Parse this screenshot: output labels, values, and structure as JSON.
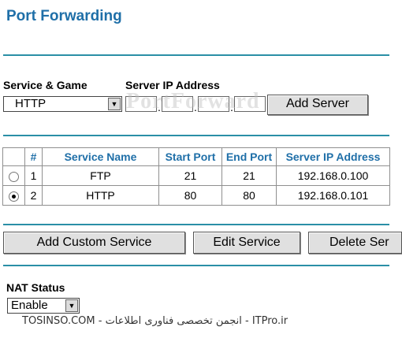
{
  "page_title": "Port Forwarding",
  "service_game": {
    "label": "Service & Game",
    "selected": "HTTP"
  },
  "server_ip": {
    "label": "Server IP Address",
    "octets": [
      "",
      "",
      "",
      ""
    ]
  },
  "add_server_label": "Add Server",
  "watermark": "PortForward",
  "table": {
    "headers": [
      "",
      "#",
      "Service Name",
      "Start Port",
      "End Port",
      "Server IP Address"
    ],
    "rows": [
      {
        "num": "1",
        "service": "FTP",
        "start": "21",
        "end": "21",
        "ip": "192.168.0.100",
        "selected": false
      },
      {
        "num": "2",
        "service": "HTTP",
        "start": "80",
        "end": "80",
        "ip": "192.168.0.101",
        "selected": true
      }
    ]
  },
  "buttons": {
    "add_custom": "Add Custom Service",
    "edit": "Edit Service",
    "delete": "Delete Ser"
  },
  "nat_status": {
    "label": "NAT Status",
    "selected": "Enable"
  },
  "footer_text": "TOSINSO.COM - انجمن تخصصی فناوری اطلاعات - ITPro.ir",
  "colors": {
    "title": "#1f6fa8",
    "rule": "#2a8fa6"
  }
}
